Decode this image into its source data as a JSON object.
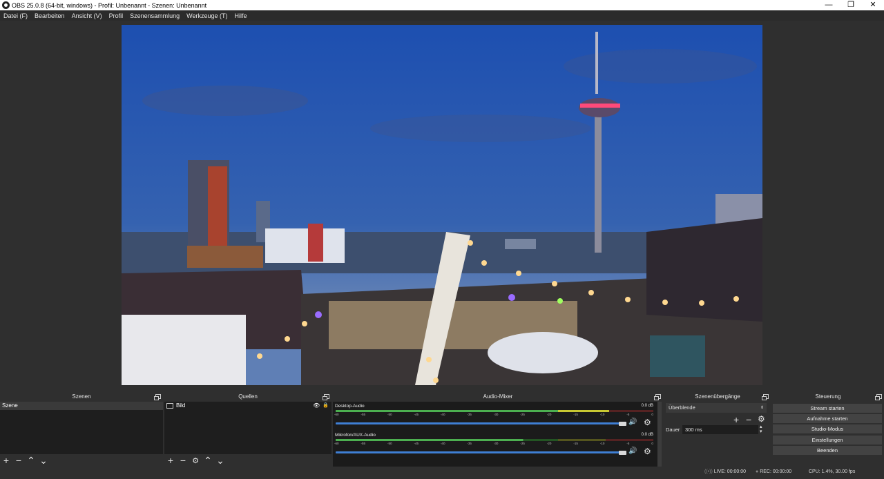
{
  "window": {
    "title": "OBS 25.0.8 (64-bit, windows) - Profil: Unbenannt - Szenen: Unbenannt",
    "minimize": "—",
    "maximize": "❐",
    "close": "✕"
  },
  "menu": [
    "Datei (F)",
    "Bearbeiten",
    "Ansicht (V)",
    "Profil",
    "Szenensammlung",
    "Werkzeuge (T)",
    "Hilfe"
  ],
  "docks": {
    "scenes": {
      "title": "Szenen",
      "items": [
        "Szene"
      ]
    },
    "sources": {
      "title": "Quellen",
      "items": [
        "Bild"
      ]
    },
    "mixer": {
      "title": "Audio-Mixer",
      "tracks": [
        {
          "name": "Desktop-Audio",
          "db": "0.0 dB",
          "level": 0.86
        },
        {
          "name": "Mikrofon/AUX-Audio",
          "db": "0.0 dB",
          "level": 0.59
        }
      ],
      "ticks": [
        "-60",
        "-55",
        "-50",
        "-45",
        "-40",
        "-35",
        "-30",
        "-25",
        "-20",
        "-15",
        "-10",
        "-5",
        "0"
      ]
    },
    "transitions": {
      "title": "Szenenübergänge",
      "selected": "Überblende",
      "duration_label": "Dauer",
      "duration_value": "300 ms"
    },
    "controls": {
      "title": "Steuerung",
      "buttons": [
        "Stream starten",
        "Aufnahme starten",
        "Studio-Modus",
        "Einstellungen",
        "Beenden"
      ]
    }
  },
  "status": {
    "live": "LIVE: 00:00:00",
    "rec": "REC: 00:00:00",
    "cpu": "CPU: 1.4%, 30.00 fps"
  },
  "icons": {
    "add": "+",
    "remove": "−",
    "up": "⌃",
    "down": "⌄",
    "gear": "⚙",
    "speaker": "🔊",
    "eye": "👁",
    "lock": "🔒"
  },
  "colors": {
    "meter_green": "#4caf50",
    "meter_yellow": "#c8c832",
    "meter_red": "#c83232",
    "volume_blue": "#3f7fd4"
  }
}
